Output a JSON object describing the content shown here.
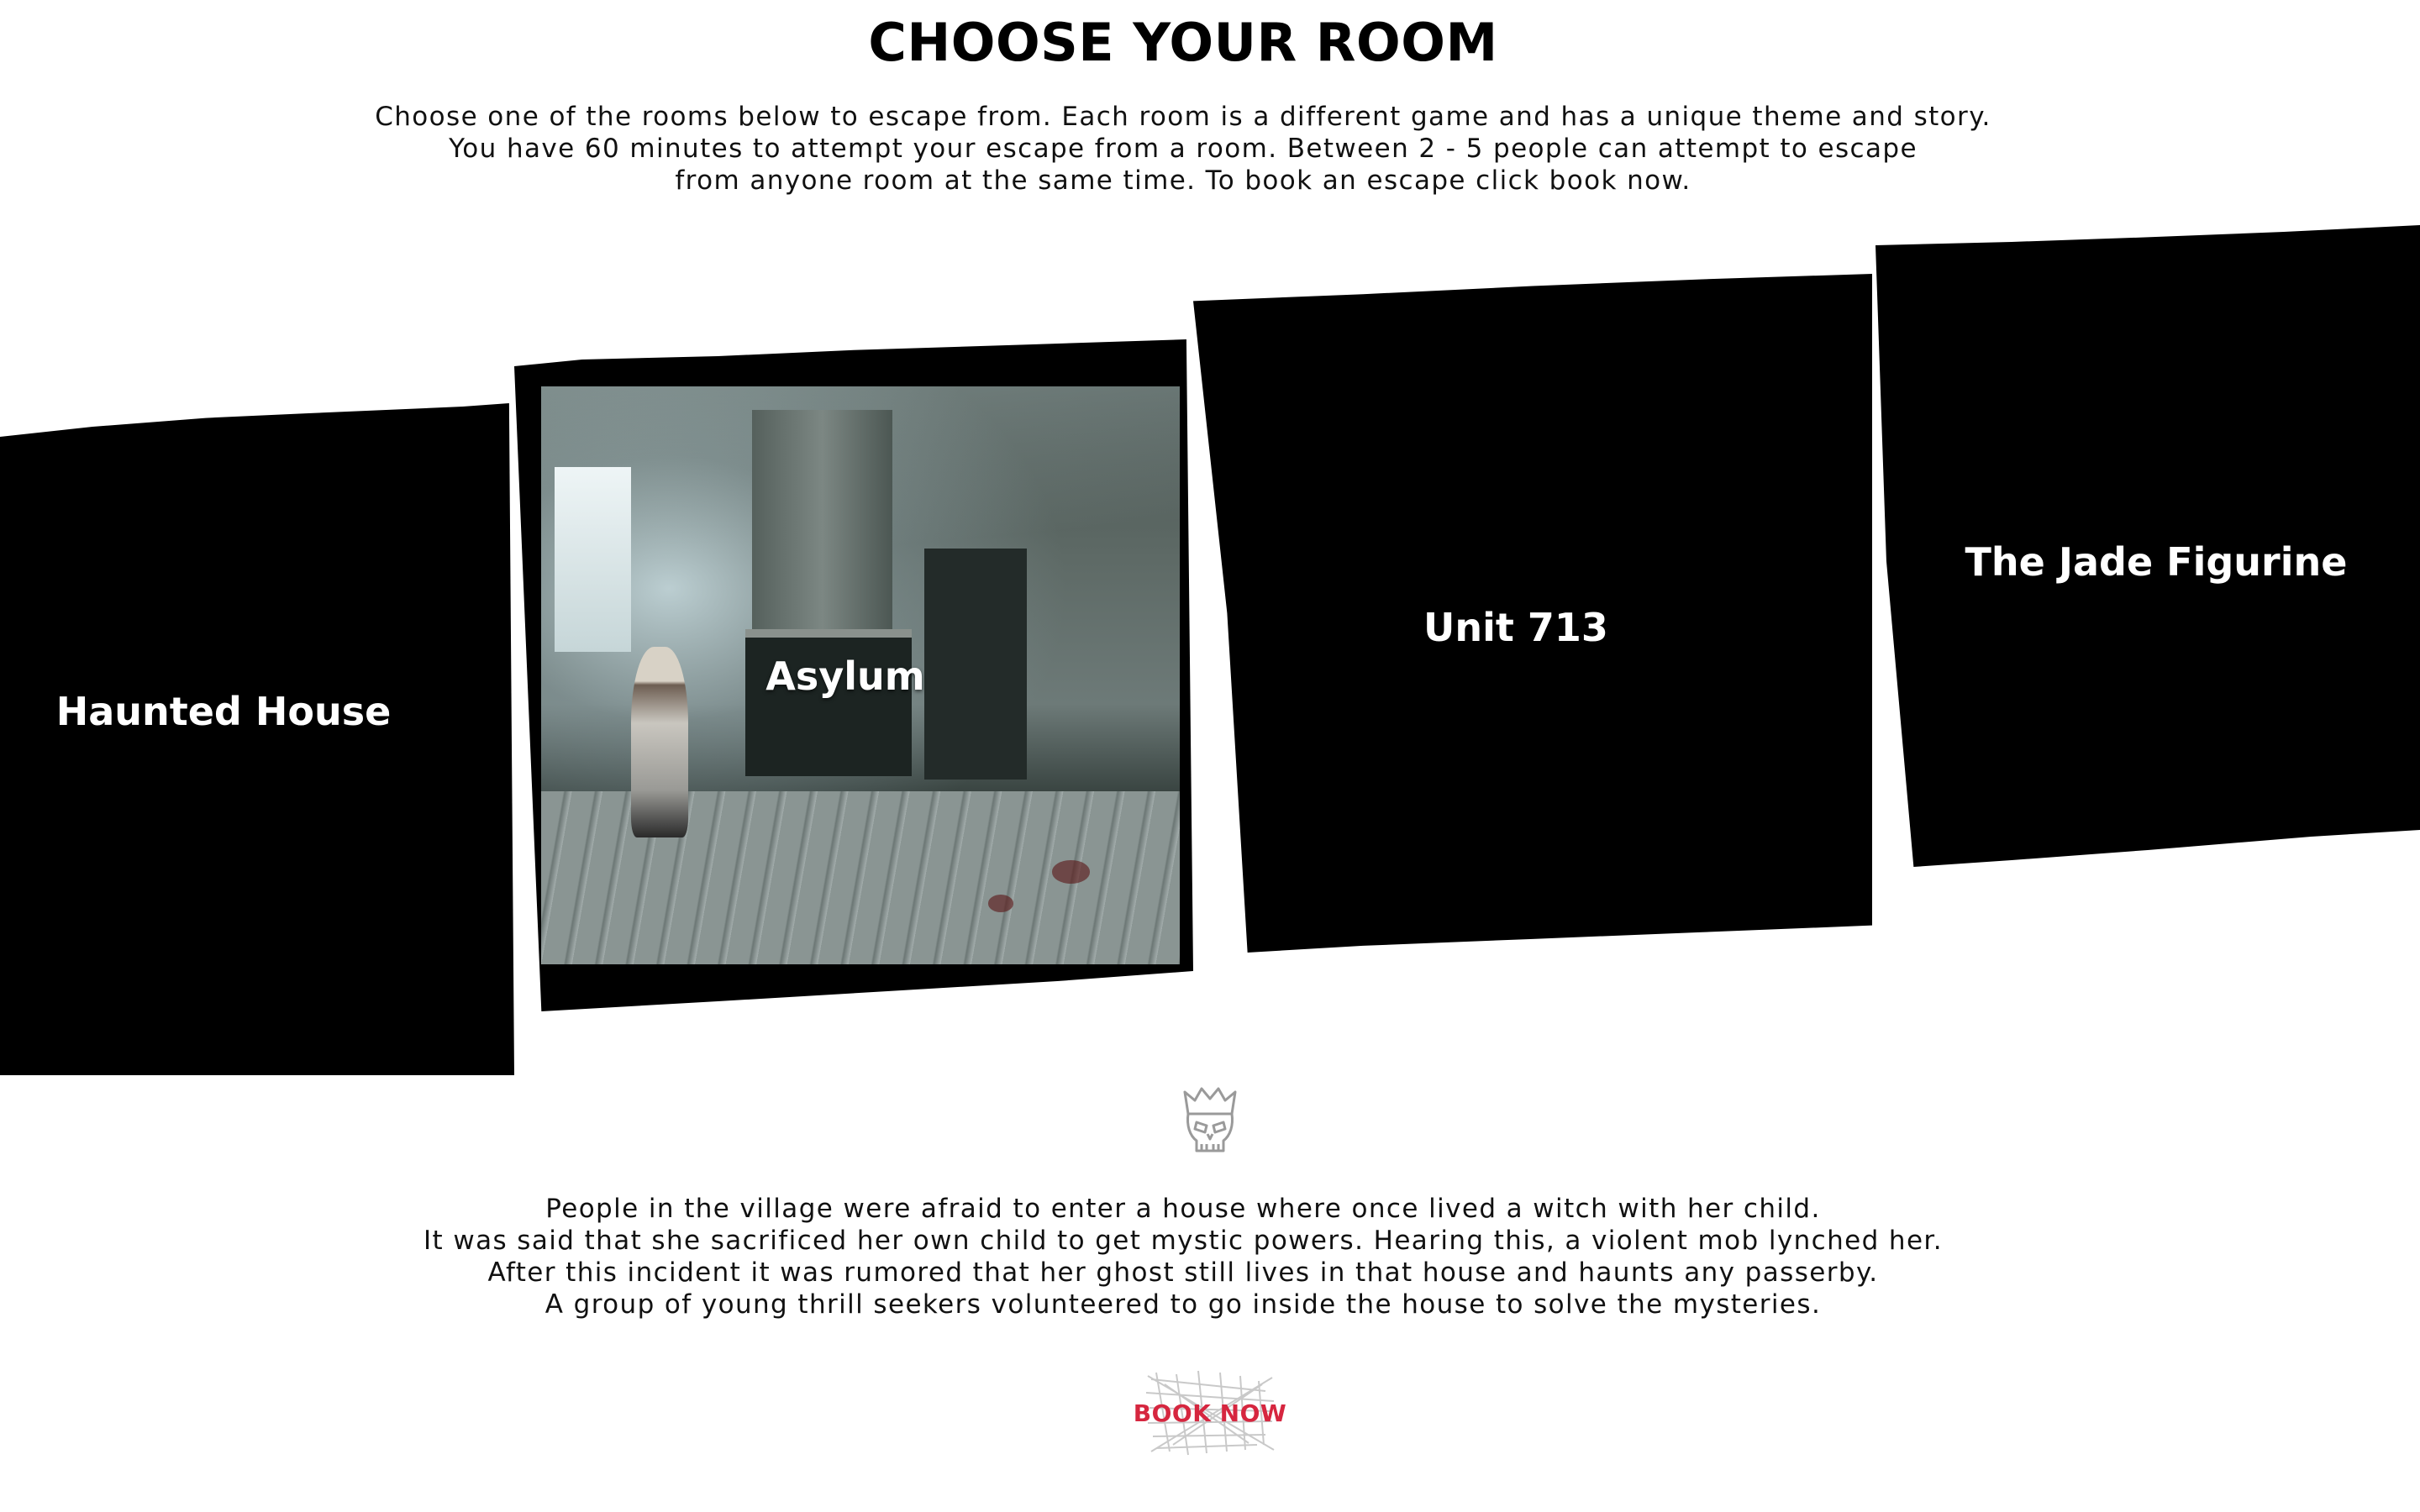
{
  "page": {
    "title": "CHOOSE YOUR ROOM",
    "intro_lines": [
      "Choose one of the rooms below to escape from. Each room is a different game and has a unique theme and story.",
      "You have 60 minutes to attempt your escape from a room. Between 2 - 5 people can attempt to escape",
      "from anyone room at the same time.  To book an escape click book now."
    ]
  },
  "rooms": [
    {
      "name": "Haunted House"
    },
    {
      "name": "Asylum"
    },
    {
      "name": "Unit 713"
    },
    {
      "name": "The Jade Figurine"
    }
  ],
  "room_description": {
    "icon": "skull-icon",
    "lines": [
      "People in the village were afraid to enter a house where once lived a witch with her child.",
      "It was said that she sacrificed her own child to get mystic powers. Hearing this, a violent mob lynched her.",
      "After this incident it was rumored that her ghost still lives in that house and haunts any passerby.",
      "A group of young thrill seekers volunteered to go inside the house to solve the mysteries."
    ]
  },
  "cta": {
    "label": "BOOK NOW",
    "color": "#d6263f"
  },
  "colors": {
    "card_background": "#000000",
    "text": "#111111"
  }
}
